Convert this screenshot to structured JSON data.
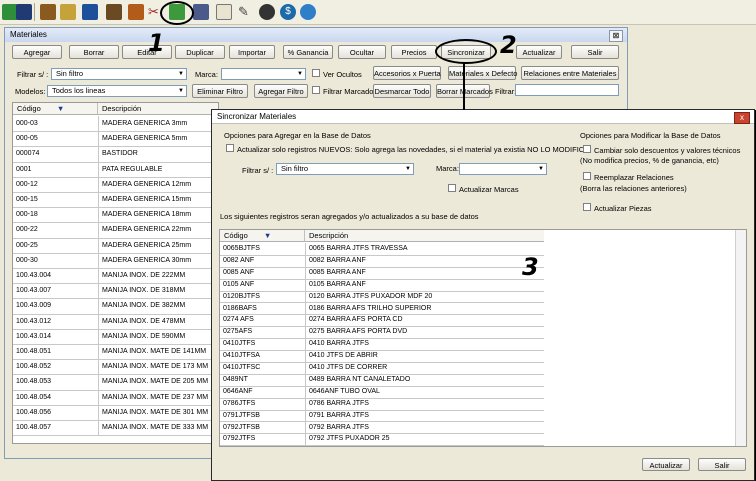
{
  "toolbar": {
    "icons": [
      "refresh-icon",
      "save-icon",
      "books-icon",
      "brush-icon",
      "monitor-icon",
      "film-icon",
      "box-icon",
      "scissors-icon",
      "materials-icon",
      "printer-icon",
      "list-icon",
      "pencil-icon",
      "disc-icon",
      "dollar-icon",
      "globe-icon"
    ]
  },
  "main_window": {
    "title": "Materiales",
    "close_glyph": "⊠",
    "buttons": {
      "agregar": "Agregar",
      "borrar": "Borrar",
      "editar": "Editar",
      "duplicar": "Duplicar",
      "importar": "Importar",
      "ganancia": "% Ganancia",
      "ocultar": "Ocultar",
      "precios": "Precios",
      "sincronizar": "Sincronizar",
      "actualizar": "Actualizar",
      "salir": "Salir",
      "accesorios": "Accesorios x Puerta",
      "materiales_defecto": "Materiales x Defecto",
      "relaciones": "Relaciones entre Materiales",
      "eliminar_filtro": "Eliminar Filtro",
      "agregar_filtro": "Agregar Filtro",
      "desmarcar": "Desmarcar Todo",
      "borrar_marcados": "Borrar Marcados"
    },
    "filtrar_label": "Filtrar s/ :",
    "filtrar_value": "Sin filtro",
    "marca_label": "Marca:",
    "marca_value": "",
    "ver_ocultos": "Ver Ocultos",
    "filtrar_marcados": "Filtrar Marcados",
    "modelos_label": "Modelos:",
    "modelos_value": "Todos los lineas",
    "filtrar_text_label": "Filtrar:",
    "grid": {
      "col_codigo": "Código",
      "col_desc": "Descripción",
      "sort_arrow": "▼",
      "rows": [
        {
          "code": "000-03",
          "desc": "MADERA GENERICA 3mm"
        },
        {
          "code": "000-05",
          "desc": "MADERA GENERICA 5mm"
        },
        {
          "code": "000074",
          "desc": "BASTIDOR"
        },
        {
          "code": "0001",
          "desc": "PATA REGULABLE"
        },
        {
          "code": "000-12",
          "desc": "MADERA GENERICA 12mm"
        },
        {
          "code": "000-15",
          "desc": "MADERA GENERICA 15mm"
        },
        {
          "code": "000-18",
          "desc": "MADERA GENERICA 18mm"
        },
        {
          "code": "000-22",
          "desc": "MADERA GENERICA 22mm"
        },
        {
          "code": "000-25",
          "desc": "MADERA GENERICA 25mm"
        },
        {
          "code": "000-30",
          "desc": "MADERA GENERICA 30mm"
        },
        {
          "code": "100.43.004",
          "desc": "MANIJA INOX. DE 222MM"
        },
        {
          "code": "100.43.007",
          "desc": "MANIJA INOX. DE 318MM"
        },
        {
          "code": "100.43.009",
          "desc": "MANIJA INOX. DE 382MM"
        },
        {
          "code": "100.43.012",
          "desc": "MANIJA INOX. DE 478MM"
        },
        {
          "code": "100.43.014",
          "desc": "MANIJA INOX. DE 590MM"
        },
        {
          "code": "100.48.051",
          "desc": "MANIJA INOX. MATE DE 141MM"
        },
        {
          "code": "100.48.052",
          "desc": "MANIJA INOX. MATE DE 173 MM"
        },
        {
          "code": "100.48.053",
          "desc": "MANIJA INOX. MATE DE 205 MM"
        },
        {
          "code": "100.48.054",
          "desc": "MANIJA INOX. MATE DE 237 MM"
        },
        {
          "code": "100.48.056",
          "desc": "MANIJA INOX. MATE DE 301 MM"
        },
        {
          "code": "100.48.057",
          "desc": "MANIJA INOX. MATE DE 333 MM"
        }
      ]
    }
  },
  "sync_dialog": {
    "title": "Sincronizar Materiales",
    "close_glyph": "x",
    "group_add": "Opciones para Agregar en la Base de Datos",
    "only_new": "Actualizar solo registros NUEVOS: Solo agrega las novedades, si el material ya existia NO LO MODIFICA.",
    "filtrar_label": "Filtrar s/ :",
    "filtrar_value": "Sin filtro",
    "marca_label": "Marca:",
    "marca_value": "",
    "actualizar_marcas": "Actualizar Marcas",
    "group_modify": "Opciones para Modificar la Base de Datos",
    "cambiar_solo": "Cambiar solo descuentos y valores técnicos",
    "cambiar_solo_note": "(No modifica precios, % de ganancia, etc)",
    "reemplazar": "Reemplazar Relaciones",
    "reemplazar_note": "(Borra las relaciones anteriores)",
    "actualizar_piezas": "Actualizar Piezas",
    "info": "Los siguientes registros seran agregados y/o actualizados a su base de datos",
    "grid": {
      "col_codigo": "Código",
      "col_desc": "Descripción",
      "sort_arrow": "▼",
      "rows": [
        {
          "code": "0065BJTFS",
          "desc": "0065 BARRA JTFS TRAVESSA"
        },
        {
          "code": "0082 ANF",
          "desc": "0082 BARRA ANF"
        },
        {
          "code": "0085 ANF",
          "desc": "0085 BARRA ANF"
        },
        {
          "code": "0105 ANF",
          "desc": "0105 BARRA ANF"
        },
        {
          "code": "0120BJTFS",
          "desc": "0120 BARRA JTFS PUXADOR MDF 20"
        },
        {
          "code": "0186BAFS",
          "desc": "0186 BARRA AFS TRILHO SUPERIOR"
        },
        {
          "code": "0274 AFS",
          "desc": "0274 BARRA AFS PORTA CD"
        },
        {
          "code": "0275AFS",
          "desc": "0275 BARRA AFS  PORTA DVD"
        },
        {
          "code": "0410JTFS",
          "desc": "0410 BARRA JTFS"
        },
        {
          "code": "0410JTFSA",
          "desc": "0410 JTFS DE ABRIR"
        },
        {
          "code": "0410JTFSC",
          "desc": "0410 JTFS DE CORRER"
        },
        {
          "code": "0489NT",
          "desc": "0489 BARRA NT CANALETADO"
        },
        {
          "code": "0646ANF",
          "desc": "0646ANF TUBO OVAL"
        },
        {
          "code": "0786JTFS",
          "desc": "0786 BARRA JTFS"
        },
        {
          "code": "0791JTFSB",
          "desc": "0791 BARRA JTFS"
        },
        {
          "code": "0792JTFSB",
          "desc": "0792 BARRA JTFS"
        },
        {
          "code": "0792JTFS",
          "desc": "0792 JTFS PUXADOR 25"
        }
      ]
    },
    "btn_actualizar": "Actualizar",
    "btn_salir": "Salir"
  },
  "annotations": {
    "n1": "1",
    "n2": "2",
    "n3": "3"
  },
  "colors": {
    "window_bg": "#ece9d8",
    "grid_border": "#c8c8c8",
    "title_bar": "#c9d7ef",
    "close_red": "#c9432f"
  }
}
